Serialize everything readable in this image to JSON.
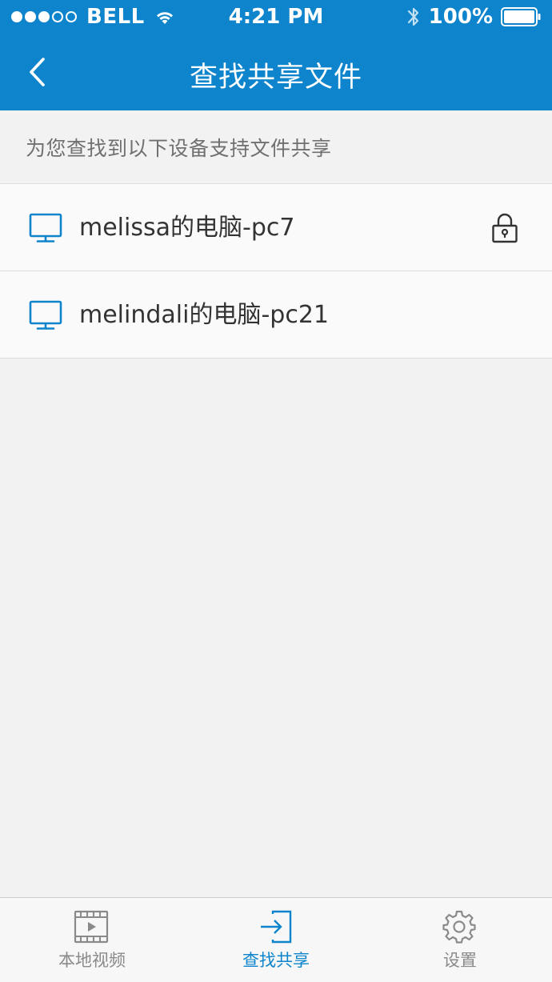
{
  "status_bar": {
    "carrier": "BELL",
    "time": "4:21 PM",
    "battery": "100%",
    "signal_filled": 3,
    "signal_total": 5
  },
  "nav": {
    "title": "查找共享文件",
    "back_icon": "chevron-left-icon"
  },
  "hint": "为您查找到以下设备支持文件共享",
  "devices": [
    {
      "name": "melissa的电脑-pc7",
      "icon": "monitor-icon",
      "locked": true
    },
    {
      "name": "melindali的电脑-pc21",
      "icon": "monitor-icon",
      "locked": false
    }
  ],
  "tabs": [
    {
      "label": "本地视频",
      "icon": "video-film-icon",
      "active": false
    },
    {
      "label": "查找共享",
      "icon": "share-enter-icon",
      "active": true
    },
    {
      "label": "设置",
      "icon": "gear-icon",
      "active": false
    }
  ],
  "colors": {
    "accent": "#0d84cc",
    "inactive": "#8a8a8a",
    "background": "#f2f2f2"
  }
}
